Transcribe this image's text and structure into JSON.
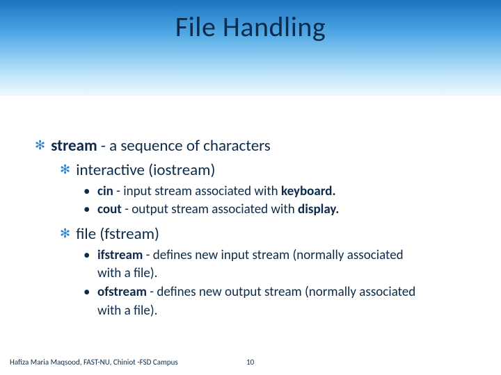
{
  "title": "File Handling",
  "bullets": {
    "l1_stream_label": "stream",
    "l1_stream_rest": " - a sequence of characters",
    "l2_interactive": "interactive (iostream)",
    "l3_cin_label": "cin",
    "l3_cin_rest": " - input stream associated with ",
    "l3_cin_kw": "keyboard.",
    "l3_cout_label": "cout",
    "l3_cout_rest": " - output stream associated with ",
    "l3_cout_kw": "display.",
    "l2_file": "file (fstream)",
    "l3_ifstream_label": "ifstream",
    "l3_ifstream_rest": " - defines new input stream (normally associated",
    "l3_ifstream_cont": "with a file).",
    "l3_ofstream_label": "ofstream",
    "l3_ofstream_rest": " - defines new output stream (normally associated",
    "l3_ofstream_cont": "with a file)."
  },
  "footer": {
    "author": "Hafiza Maria Maqsood, FAST-NU, Chiniot -FSD Campus",
    "page": "10"
  }
}
